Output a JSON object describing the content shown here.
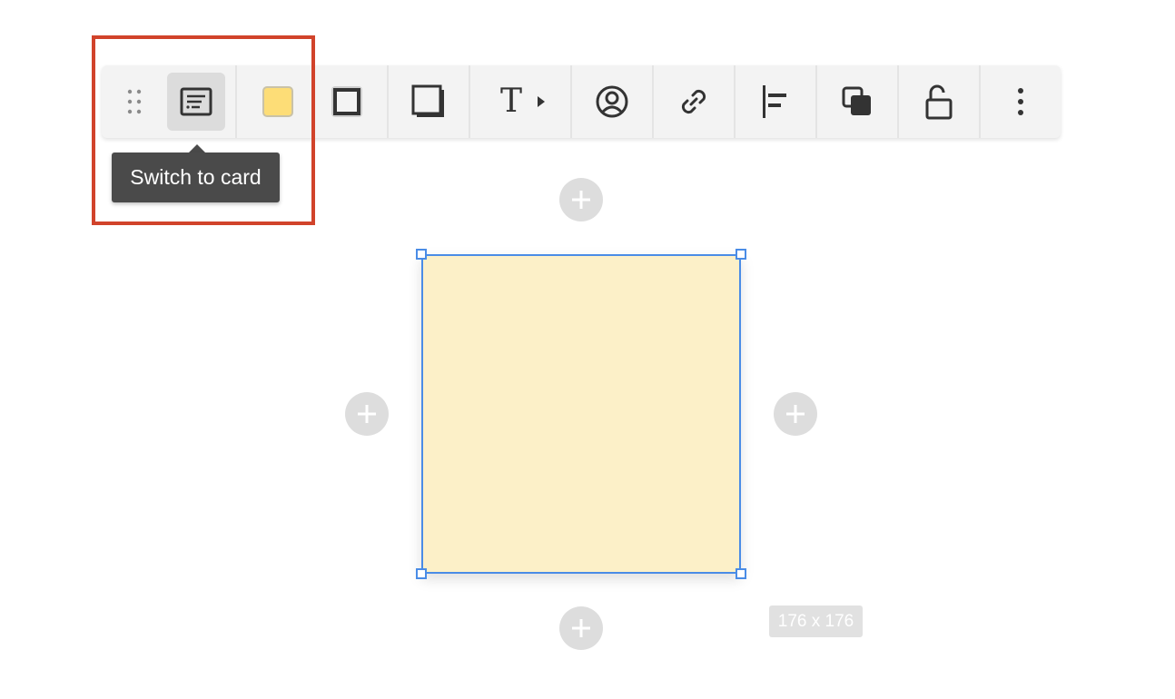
{
  "tooltip": {
    "text": "Switch to card"
  },
  "toolbar": {
    "items": [
      {
        "name": "drag-handle",
        "icon": "drag-dots-icon"
      },
      {
        "name": "switch-to-card",
        "icon": "card-icon",
        "active": true
      },
      {
        "name": "fill-color",
        "icon": "fill-swatch-icon",
        "color": "#fddd77"
      },
      {
        "name": "border-style",
        "icon": "border-icon"
      },
      {
        "name": "shadow",
        "icon": "shadow-icon"
      },
      {
        "name": "text-style",
        "icon": "text-icon",
        "label": "T"
      },
      {
        "name": "assign-user",
        "icon": "user-circle-icon"
      },
      {
        "name": "link",
        "icon": "link-icon"
      },
      {
        "name": "align",
        "icon": "align-left-icon"
      },
      {
        "name": "arrange",
        "icon": "layers-icon"
      },
      {
        "name": "lock",
        "icon": "unlock-icon"
      },
      {
        "name": "more",
        "icon": "more-vertical-icon"
      }
    ]
  },
  "sticky": {
    "fill_color": "#fcf0c8",
    "border_color": "#4a8ce6"
  },
  "size_label": "176 x 176",
  "colors": {
    "highlight": "#d1432b",
    "tooltip_bg": "#4a4a4a",
    "toolbar_bg": "#f3f3f3"
  }
}
